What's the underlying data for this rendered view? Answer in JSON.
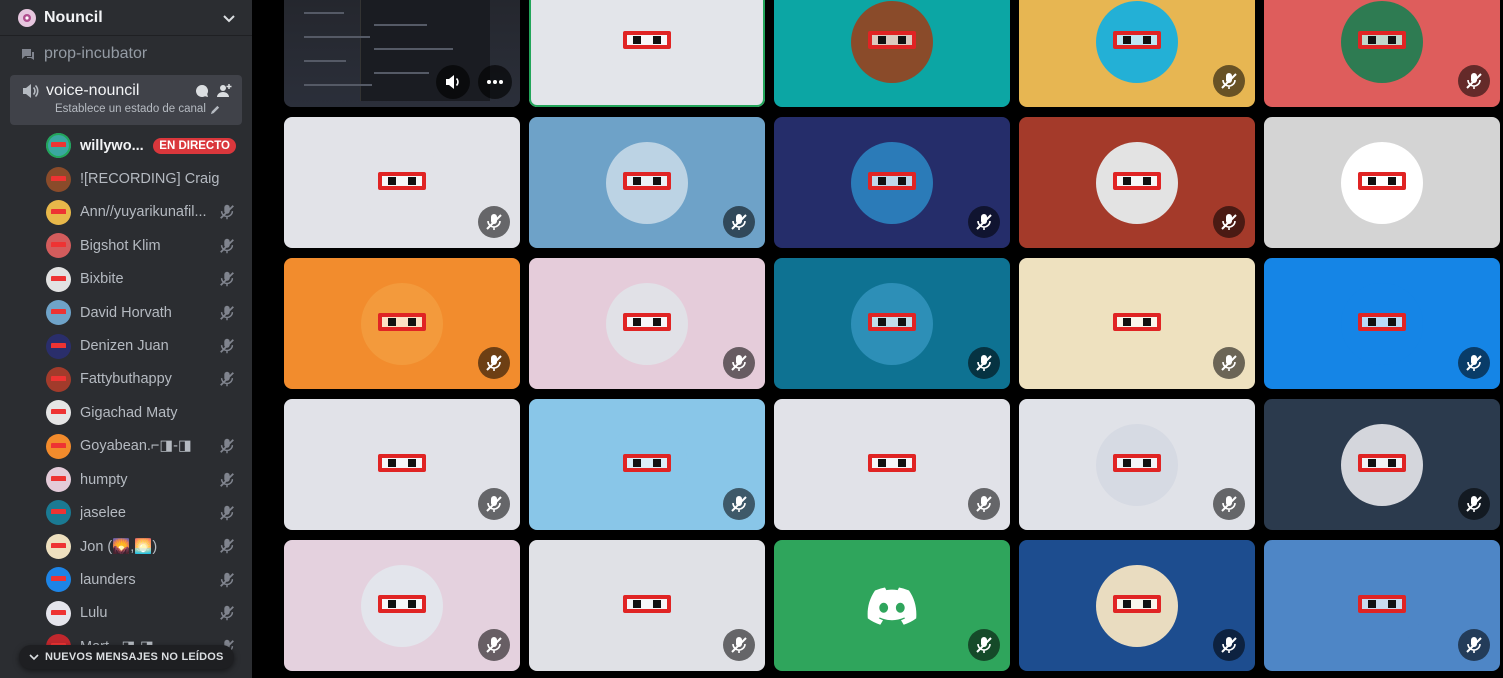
{
  "server": {
    "name": "Nouncil"
  },
  "channels": {
    "prev": "prop-incubator",
    "voice": {
      "name": "voice-nouncil",
      "status": "Establece un estado de canal"
    }
  },
  "live_badge": "EN DIRECTO",
  "unread_pill": "NUEVOS MENSAJES NO LEÍDOS",
  "users": [
    {
      "name": "willywo...",
      "color": "#3aa7a0",
      "speaking": true,
      "live": true,
      "muted": false
    },
    {
      "name": "![RECORDING] Craig",
      "color": "#8a4b2a",
      "muted": false
    },
    {
      "name": "Ann//yuyarikunafil...",
      "color": "#e8b84a",
      "muted": true
    },
    {
      "name": "Bigshot Klim",
      "color": "#d35c5c",
      "muted": true
    },
    {
      "name": "Bixbite",
      "color": "#e2e2e2",
      "muted": true
    },
    {
      "name": "David Horvath",
      "color": "#6fa3c9",
      "muted": true
    },
    {
      "name": "Denizen Juan",
      "color": "#2a2e6b",
      "muted": true
    },
    {
      "name": "Fattybuthappy",
      "color": "#a23b2b",
      "muted": true
    },
    {
      "name": "Gigachad Maty",
      "color": "#e5e5e5",
      "muted": false
    },
    {
      "name": "Goyabean.⌐◨-◨",
      "color": "#f28b2c",
      "muted": true
    },
    {
      "name": "humpty",
      "color": "#e4cbd9",
      "muted": true
    },
    {
      "name": "jaselee",
      "color": "#1a7a93",
      "muted": true
    },
    {
      "name": "Jon (🌄,🌅)",
      "color": "#eee0bf",
      "muted": true
    },
    {
      "name": "launders",
      "color": "#1d84e6",
      "muted": true
    },
    {
      "name": "Lulu",
      "color": "#e5e5ec",
      "muted": true
    },
    {
      "name": "Mart ⌐◨-◨",
      "color": "#c1272d",
      "muted": true
    }
  ],
  "tiles": [
    {
      "kind": "screen"
    },
    {
      "kind": "avatar",
      "bg": "#e3e5ea",
      "av": "#e3e5ea",
      "speaking": true,
      "muted": false,
      "label": "willywo-tile"
    },
    {
      "kind": "avatar",
      "bg": "#0ca6a4",
      "av": "#8a4b2a",
      "muted": false,
      "label": "craig-tile"
    },
    {
      "kind": "avatar",
      "bg": "#e7b652",
      "av": "#23b0d6",
      "muted": true,
      "label": "ann-tile"
    },
    {
      "kind": "avatar",
      "bg": "#de5d5c",
      "av": "#2e7b52",
      "muted": true,
      "label": "bigshot-tile"
    },
    {
      "kind": "avatar",
      "bg": "#e2e3e8",
      "av": "#e2e3e8",
      "muted": true,
      "label": "bixbite-tile"
    },
    {
      "kind": "avatar",
      "bg": "#6ea2c8",
      "av": "#bcd3e4",
      "muted": true,
      "label": "david-tile"
    },
    {
      "kind": "avatar",
      "bg": "#252d6a",
      "av": "#2b7bb8",
      "muted": true,
      "label": "denizen-tile"
    },
    {
      "kind": "avatar",
      "bg": "#a43a2a",
      "av": "#e3e3e3",
      "muted": true,
      "label": "fatty-tile"
    },
    {
      "kind": "avatar",
      "bg": "#d4d4d4",
      "av": "#ffffff",
      "muted": false,
      "label": "gigachad-tile"
    },
    {
      "kind": "avatar",
      "bg": "#f28c2d",
      "av": "#f39a3c",
      "muted": true,
      "label": "goyabean-tile"
    },
    {
      "kind": "avatar",
      "bg": "#e5ccda",
      "av": "#e1e1e7",
      "muted": true,
      "label": "humpty-tile"
    },
    {
      "kind": "avatar",
      "bg": "#0e7292",
      "av": "#2d8fb7",
      "muted": true,
      "label": "jaselee-tile"
    },
    {
      "kind": "avatar",
      "bg": "#eee1bf",
      "av": "#eee1bf",
      "muted": true,
      "label": "jon-tile"
    },
    {
      "kind": "avatar",
      "bg": "#1585e6",
      "av": "#1585e6",
      "muted": true,
      "label": "launders-tile"
    },
    {
      "kind": "avatar",
      "bg": "#e1e2e8",
      "av": "#e1e2e8",
      "muted": true,
      "label": "lulu-tile"
    },
    {
      "kind": "avatar",
      "bg": "#89c6e8",
      "av": "#89c6e8",
      "muted": true,
      "label": "tile-17"
    },
    {
      "kind": "avatar",
      "bg": "#e1e2e8",
      "av": "#e1e2e8",
      "muted": true,
      "label": "tile-18"
    },
    {
      "kind": "avatar",
      "bg": "#e0e2e8",
      "av": "#d6dae3",
      "muted": true,
      "label": "tile-19"
    },
    {
      "kind": "avatar",
      "bg": "#2b3a4d",
      "av": "#d4d6dc",
      "muted": true,
      "label": "tile-20"
    },
    {
      "kind": "avatar",
      "bg": "#e4d1de",
      "av": "#e3e5ec",
      "muted": true,
      "label": "tile-21"
    },
    {
      "kind": "avatar",
      "bg": "#e0e1e6",
      "av": "#e0e1e6",
      "muted": true,
      "label": "tile-22"
    },
    {
      "kind": "discord",
      "bg": "#2fa55c",
      "muted": true,
      "label": "tile-23"
    },
    {
      "kind": "avatar",
      "bg": "#1d4d8f",
      "av": "#e9dcc0",
      "muted": true,
      "label": "tile-24"
    },
    {
      "kind": "avatar",
      "bg": "#4e86c6",
      "av": "#4e86c6",
      "muted": true,
      "label": "tile-25"
    }
  ]
}
